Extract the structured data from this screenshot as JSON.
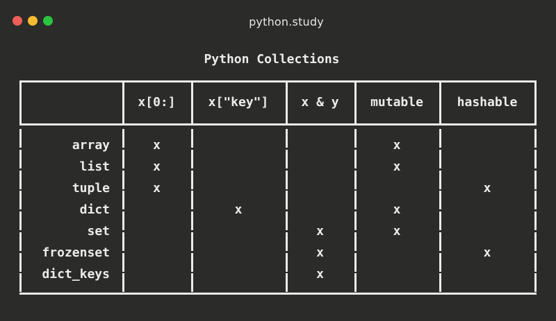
{
  "window": {
    "title": "python.study",
    "controls": {
      "close_color": "#ee5f57",
      "minimize_color": "#f5bd2f",
      "maximize_color": "#29c440"
    }
  },
  "table": {
    "title": "Python Collections",
    "columns": [
      "",
      "x[0:]",
      "x[\"key\"]",
      "x & y",
      "mutable",
      "hashable"
    ],
    "rows": [
      {
        "name": "array",
        "cells": [
          "x",
          "",
          "",
          "x",
          ""
        ]
      },
      {
        "name": "list",
        "cells": [
          "x",
          "",
          "",
          "x",
          ""
        ]
      },
      {
        "name": "tuple",
        "cells": [
          "x",
          "",
          "",
          "",
          "x"
        ]
      },
      {
        "name": "dict",
        "cells": [
          "",
          "x",
          "",
          "x",
          ""
        ]
      },
      {
        "name": "set",
        "cells": [
          "",
          "",
          "x",
          "x",
          ""
        ]
      },
      {
        "name": "frozenset",
        "cells": [
          "",
          "",
          "x",
          "",
          "x"
        ]
      },
      {
        "name": "dict_keys",
        "cells": [
          "",
          "",
          "x",
          "",
          ""
        ]
      }
    ]
  }
}
